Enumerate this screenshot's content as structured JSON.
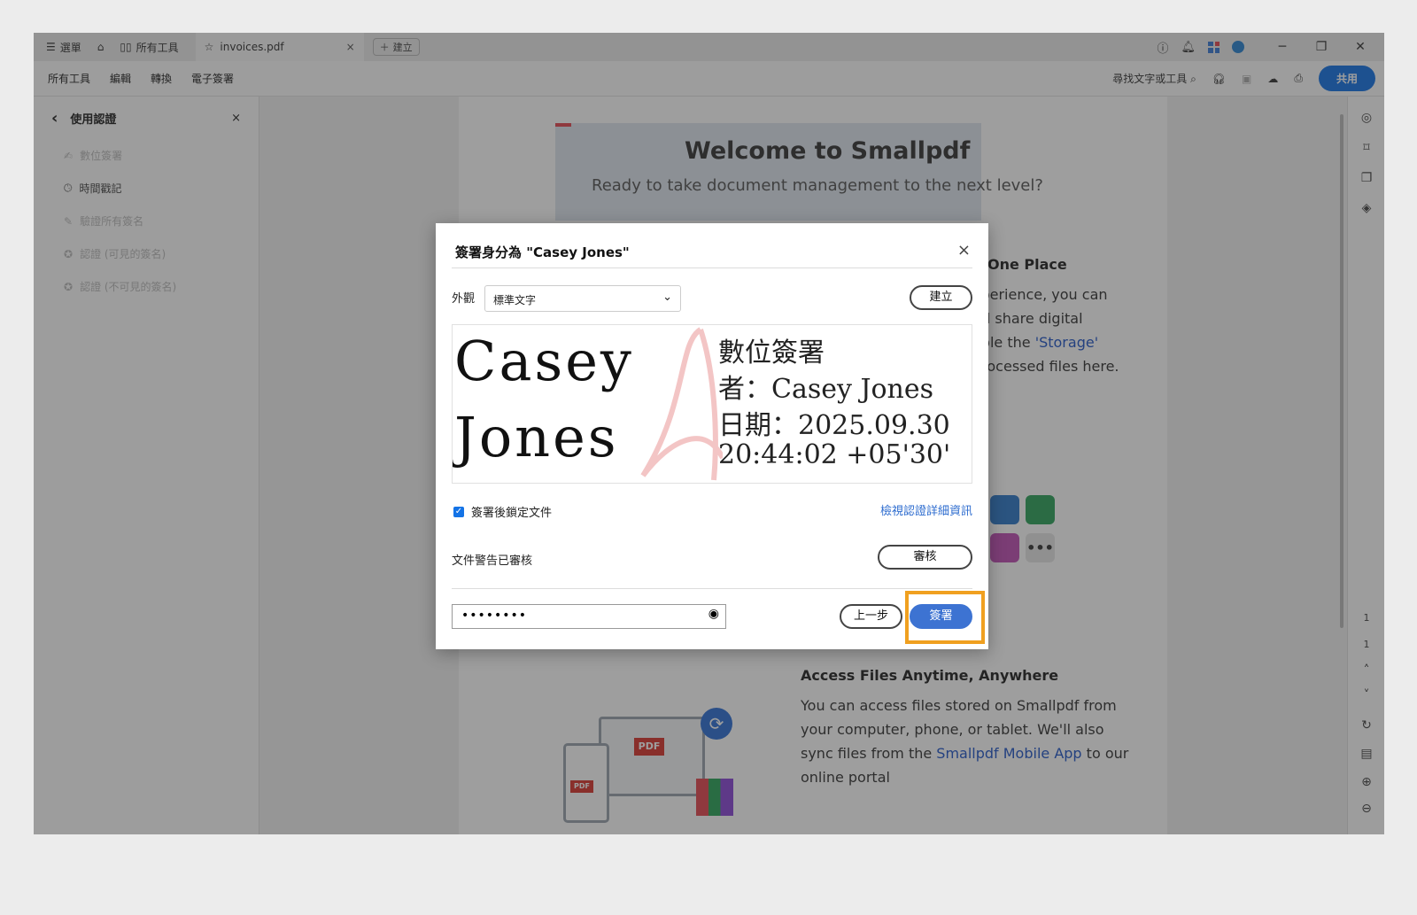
{
  "titlebar": {
    "menu_label": "選單",
    "all_tools_label": "所有工具",
    "tab_title": "invoices.pdf",
    "tab_close": "×",
    "new_tab_label": "建立",
    "minimize": "─",
    "restore": "❐",
    "close": "✕"
  },
  "menubar": {
    "items": [
      "所有工具",
      "編輯",
      "轉換",
      "電子簽署"
    ],
    "search_label": "尋找文字或工具",
    "share_label": "共用"
  },
  "left_panel": {
    "title": "使用認證",
    "close": "×",
    "items": [
      {
        "label": "數位簽署",
        "enabled": false
      },
      {
        "label": "時間戳記",
        "enabled": true
      },
      {
        "label": "驗證所有簽名",
        "enabled": false
      },
      {
        "label": "認證 (可見的簽名)",
        "enabled": false
      },
      {
        "label": "認證 (不可見的簽名)",
        "enabled": false
      }
    ]
  },
  "document": {
    "welcome_title": "Welcome to Smallpdf",
    "welcome_subtitle_prefix": "Ready to take document management to the next ",
    "welcome_subtitle_suffix": "level?",
    "section1_title_partial": "n One Place",
    "section1_lines": [
      "xperience, you can",
      "nd share digital",
      "able the ",
      "'Storage'",
      " processed files here."
    ],
    "section2_title": "Access Files Anytime, Anywhere",
    "section2_line1": "You can access files stored on Smallpdf from",
    "section2_line2": "your computer, phone, or tablet. We'll also",
    "section2_line3_prefix": "sync files from the ",
    "section2_link": "Smallpdf Mobile App",
    "section2_line3_suffix": " to our",
    "section2_line4": "online portal",
    "pdf_badge": "PDF",
    "page_number": "1",
    "page_total": "1"
  },
  "dialog": {
    "title": "簽署身分為 \"Casey Jones\"",
    "close": "×",
    "appearance_label": "外觀",
    "appearance_value": "標準文字",
    "create_label": "建立",
    "signature_name_line1": "Casey",
    "signature_name_line2": "Jones",
    "signature_info": [
      "數位簽署",
      "者：Casey Jones",
      "日期：2025.09.30",
      "20:44:02 +05'30'"
    ],
    "lock_label": "簽署後鎖定文件",
    "lock_checked": true,
    "view_cert_link": "檢視認證詳細資訊",
    "warnings_label": "文件警告已審核",
    "review_label": "審核",
    "password_value": "••••••••",
    "back_label": "上一步",
    "sign_label": "簽署"
  },
  "colors": {
    "accent": "#1473e6",
    "sign_button": "#3d73d2",
    "highlight": "#f0a020",
    "link": "#2156c9"
  }
}
